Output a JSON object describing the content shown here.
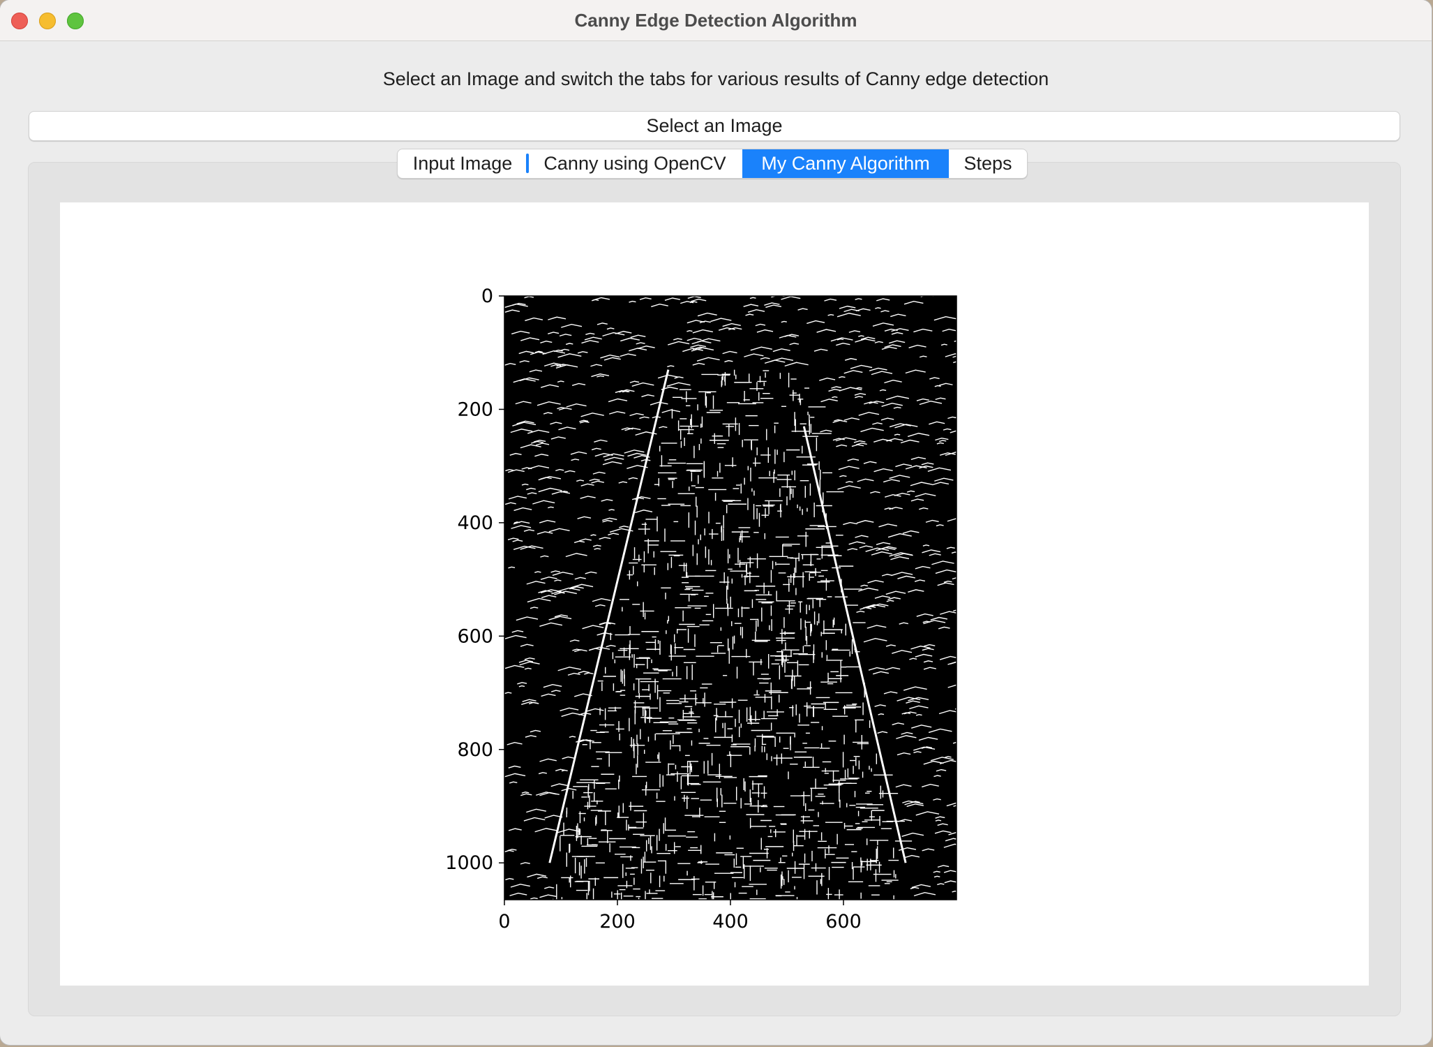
{
  "window": {
    "title": "Canny Edge Detection Algorithm"
  },
  "instruction": "Select an Image and switch the tabs for various results of Canny edge detection",
  "select_button": "Select an Image",
  "tabs": [
    {
      "label": "Input Image",
      "selected": false
    },
    {
      "label": "Canny using OpenCV",
      "selected": false
    },
    {
      "label": "My Canny Algorithm",
      "selected": true
    },
    {
      "label": "Steps",
      "selected": false
    }
  ],
  "chart_data": {
    "type": "image",
    "title": "",
    "xlabel": "",
    "ylabel": "",
    "xlim": [
      0,
      800
    ],
    "ylim": [
      1065,
      0
    ],
    "xticks": [
      "0",
      "200",
      "400",
      "600"
    ],
    "yticks": [
      "0",
      "200",
      "400",
      "600",
      "800",
      "1000"
    ],
    "content": "binary edge map",
    "colors": {
      "background": "#000000",
      "edges": "#ffffff"
    }
  },
  "colors": {
    "accent": "#1a82fb",
    "window_bg": "#ececec"
  }
}
